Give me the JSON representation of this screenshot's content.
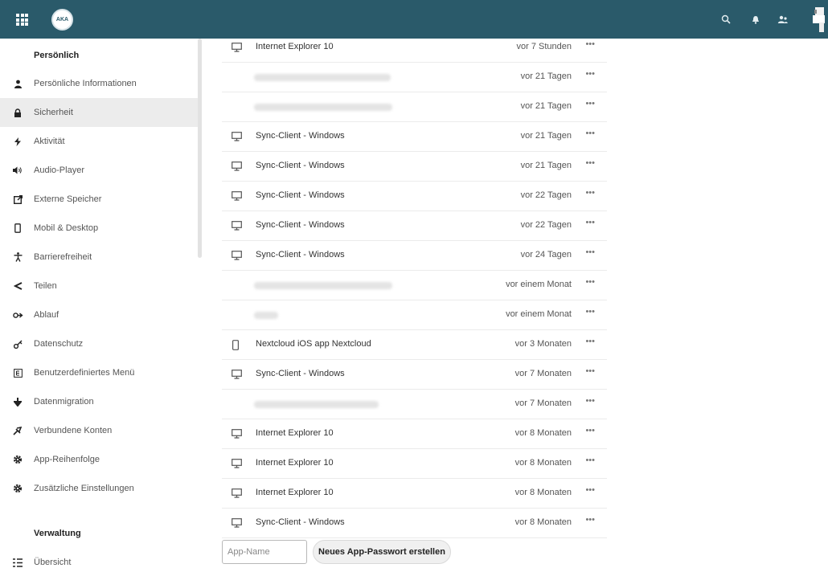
{
  "header": {
    "logo_text": "AKA",
    "apps_icon": "apps-grid-icon",
    "search_icon": "search-icon",
    "notifications_icon": "bell-icon",
    "contacts_icon": "contacts-icon",
    "color": "#2a5a6a"
  },
  "sidebar": {
    "personal_heading": "Persönlich",
    "admin_heading": "Verwaltung",
    "items": [
      {
        "label": "Persönliche Informationen",
        "icon": "user-icon"
      },
      {
        "label": "Sicherheit",
        "icon": "lock-icon",
        "active": true
      },
      {
        "label": "Aktivität",
        "icon": "activity-icon"
      },
      {
        "label": "Audio-Player",
        "icon": "speaker-icon"
      },
      {
        "label": "Externe Speicher",
        "icon": "external-storage-icon"
      },
      {
        "label": "Mobil & Desktop",
        "icon": "phone-icon"
      },
      {
        "label": "Barrierefreiheit",
        "icon": "accessibility-icon"
      },
      {
        "label": "Teilen",
        "icon": "share-icon"
      },
      {
        "label": "Ablauf",
        "icon": "flow-icon"
      },
      {
        "label": "Datenschutz",
        "icon": "privacy-key-icon"
      },
      {
        "label": "Benutzerdefiniertes Menü",
        "icon": "custom-menu-icon"
      },
      {
        "label": "Datenmigration",
        "icon": "download-arrow-icon"
      },
      {
        "label": "Verbundene Konten",
        "icon": "connected-accounts-icon"
      },
      {
        "label": "App-Reihenfolge",
        "icon": "gear-icon"
      },
      {
        "label": "Zusätzliche Einstellungen",
        "icon": "gear-icon"
      }
    ],
    "admin_items": [
      {
        "label": "Übersicht",
        "icon": "overview-list-icon"
      }
    ]
  },
  "sessions": [
    {
      "name": "Internet Explorer 10",
      "time": "vor 7 Stunden",
      "device": "desktop"
    },
    {
      "name": "",
      "time": "vor 21 Tagen",
      "device": "none"
    },
    {
      "name": "",
      "time": "vor 21 Tagen",
      "device": "none"
    },
    {
      "name": "Sync-Client - Windows",
      "time": "vor 21 Tagen",
      "device": "desktop"
    },
    {
      "name": "Sync-Client - Windows",
      "time": "vor 21 Tagen",
      "device": "desktop"
    },
    {
      "name": "Sync-Client - Windows",
      "time": "vor 22 Tagen",
      "device": "desktop"
    },
    {
      "name": "Sync-Client - Windows",
      "time": "vor 22 Tagen",
      "device": "desktop"
    },
    {
      "name": "Sync-Client - Windows",
      "time": "vor 24 Tagen",
      "device": "desktop"
    },
    {
      "name": "",
      "time": "vor einem Monat",
      "device": "none"
    },
    {
      "name": "",
      "time": "vor einem Monat",
      "device": "none"
    },
    {
      "name": "Nextcloud iOS app Nextcloud",
      "time": "vor 3 Monaten",
      "device": "phone"
    },
    {
      "name": "Sync-Client - Windows",
      "time": "vor 7 Monaten",
      "device": "desktop"
    },
    {
      "name": "",
      "time": "vor 7 Monaten",
      "device": "none"
    },
    {
      "name": "Internet Explorer 10",
      "time": "vor 8 Monaten",
      "device": "desktop"
    },
    {
      "name": "Internet Explorer 10",
      "time": "vor 8 Monaten",
      "device": "desktop"
    },
    {
      "name": "Internet Explorer 10",
      "time": "vor 8 Monaten",
      "device": "desktop"
    },
    {
      "name": "Sync-Client - Windows",
      "time": "vor 8 Monaten",
      "device": "desktop"
    }
  ],
  "more_label": "•••",
  "new_app_password": {
    "placeholder": "App-Name",
    "button_label": "Neues App-Passwort erstellen"
  }
}
